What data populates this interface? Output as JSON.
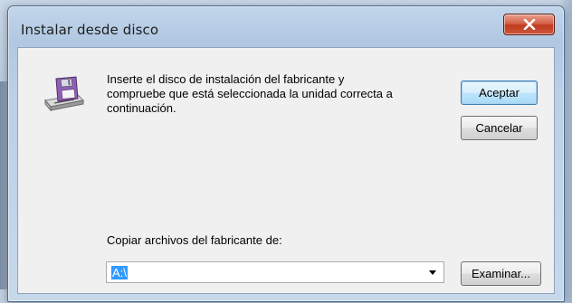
{
  "dialog": {
    "title": "Instalar desde disco",
    "close_icon": "close-x-icon",
    "disk_icon": "floppy-disk-drive-icon"
  },
  "message": {
    "line1": "Inserte el disco de instalación del fabricante y",
    "line2": "compruebe que está seleccionada la unidad correcta a",
    "line3": "continuación."
  },
  "buttons": {
    "accept": "Aceptar",
    "cancel": "Cancelar",
    "browse": "Examinar..."
  },
  "copy_from": {
    "label": "Copiar archivos del fabricante de:",
    "value": "A:\\"
  },
  "colors": {
    "accent_close": "#c0391d",
    "selection": "#3399ff"
  }
}
